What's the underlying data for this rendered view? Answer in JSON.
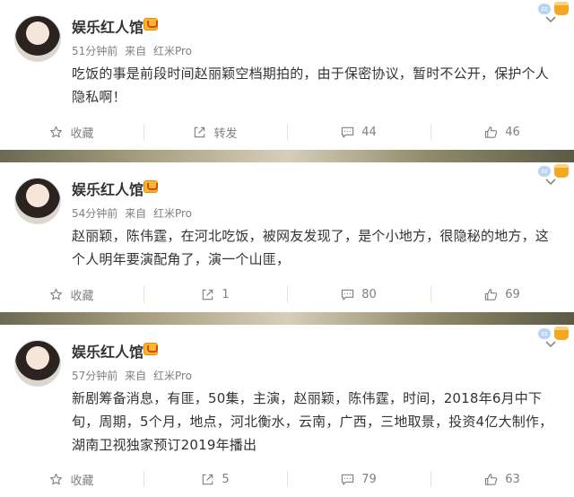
{
  "posts": [
    {
      "author": "娱乐红人馆",
      "time": "51分钟前",
      "source_prefix": "来自",
      "source": "红米Pro",
      "text": "吃饭的事是前段时间赵丽颖空档期拍的，由于保密协议，暂时不公开，保护个人隐私啊！",
      "actions": {
        "favorite": "收藏",
        "repost": "转发",
        "comments": "44",
        "likes": "46"
      }
    },
    {
      "author": "娱乐红人馆",
      "time": "54分钟前",
      "source_prefix": "来自",
      "source": "红米Pro",
      "text": "赵丽颖，陈伟霆，在河北吃饭，被网友发现了，是个小地方，很隐秘的地方，这个人明年要演配角了，演一个山匪，",
      "actions": {
        "favorite": "收藏",
        "repost": "1",
        "comments": "80",
        "likes": "69"
      }
    },
    {
      "author": "娱乐红人馆",
      "time": "57分钟前",
      "source_prefix": "来自",
      "source": "红米Pro",
      "text": "新剧筹备消息，有匪，50集，主演，赵丽颖，陈伟霆，时间，2018年6月中下旬，周期，5个月，地点，河北衡水，云南，广西，三地取景，投资4亿大制作，湖南卫视独家预订2019年播出",
      "actions": {
        "favorite": "收藏",
        "repost": "5",
        "comments": "79",
        "likes": "63"
      }
    }
  ],
  "icons": [
    "star-icon",
    "share-icon",
    "comment-icon",
    "thumbs-up-icon",
    "chevron-down-icon",
    "verified-badge-icon"
  ]
}
